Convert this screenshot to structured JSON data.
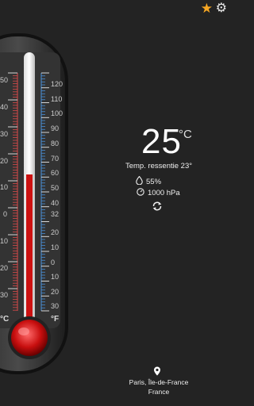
{
  "thermometer": {
    "celsius_ticks": [
      "50",
      "40",
      "30",
      "20",
      "10",
      "0",
      "10",
      "20",
      "30"
    ],
    "fahrenheit_ticks": [
      "120",
      "110",
      "100",
      "90",
      "80",
      "70",
      "60",
      "50",
      "40",
      "32",
      "20",
      "10",
      "0",
      "10",
      "20",
      "30"
    ],
    "celsius_label": "°C",
    "fahrenheit_label": "°F",
    "mercury_fraction": 0.56
  },
  "weather": {
    "temperature": "25",
    "unit": "°C",
    "feels_like": "Temp. ressentie 23°",
    "humidity": "55%",
    "pressure": "1000 hPa"
  },
  "location": {
    "line1": "Paris, Île-de-France",
    "line2": "France"
  },
  "icons": {
    "star": "star-icon",
    "settings": "gear-icon",
    "humidity": "droplet-icon",
    "pressure": "gauge-icon",
    "refresh": "refresh-icon",
    "location": "location-pin-icon"
  },
  "colors": {
    "background": "#232323",
    "mercury": "#cc1111",
    "star": "#f5a623",
    "fahrenheit_scale": "#4a90d9",
    "celsius_scale": "#d94a4a"
  }
}
